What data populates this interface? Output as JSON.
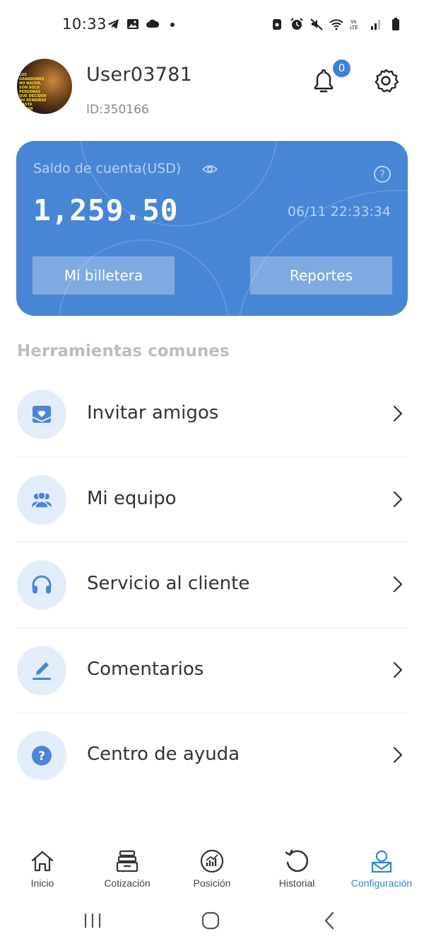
{
  "status_bar": {
    "time": "10:33",
    "left_icons": [
      "telegram-icon",
      "image-icon",
      "cloud-icon",
      "dot-icon"
    ],
    "right_icons": [
      "lock-icon",
      "alarm-icon",
      "mute-icon",
      "wifi-icon",
      "volte-icon",
      "signal-icon",
      "battery-icon"
    ]
  },
  "header": {
    "username": "User03781",
    "user_id": "ID:350166",
    "notification_count": "0",
    "avatar_text": "LOS GANADORES NO NACEN, SON SOLO PERSONAS QUE DECIDEN NO RENDIRSE HASTA GANAR"
  },
  "balance_card": {
    "label": "Saldo de cuenta(USD)",
    "balance": "1,259.50",
    "datetime": "06/11 22:33:34",
    "help_symbol": "?",
    "wallet_button": "Mi billetera",
    "reports_button": "Reportes"
  },
  "tools": {
    "section_title": "Herramientas comunes",
    "items": [
      {
        "label": "Invitar amigos",
        "icon": "invite-envelope-icon"
      },
      {
        "label": "Mi equipo",
        "icon": "team-icon"
      },
      {
        "label": "Servicio al cliente",
        "icon": "headset-icon"
      },
      {
        "label": "Comentarios",
        "icon": "pen-icon"
      },
      {
        "label": "Centro de ayuda",
        "icon": "help-icon"
      }
    ]
  },
  "bottom_nav": {
    "items": [
      {
        "label": "Inicio",
        "icon": "home-icon",
        "active": false
      },
      {
        "label": "Cotización",
        "icon": "quote-icon",
        "active": false
      },
      {
        "label": "Posición",
        "icon": "position-chart-icon",
        "active": false
      },
      {
        "label": "Historial",
        "icon": "history-icon",
        "active": false
      },
      {
        "label": "Configuración",
        "icon": "profile-settings-icon",
        "active": true
      }
    ]
  },
  "colors": {
    "accent": "#3b82d6",
    "card_bg": "#4886d5",
    "icon_circle_bg": "#e3edfa",
    "muted_text": "#bdbdbd"
  }
}
